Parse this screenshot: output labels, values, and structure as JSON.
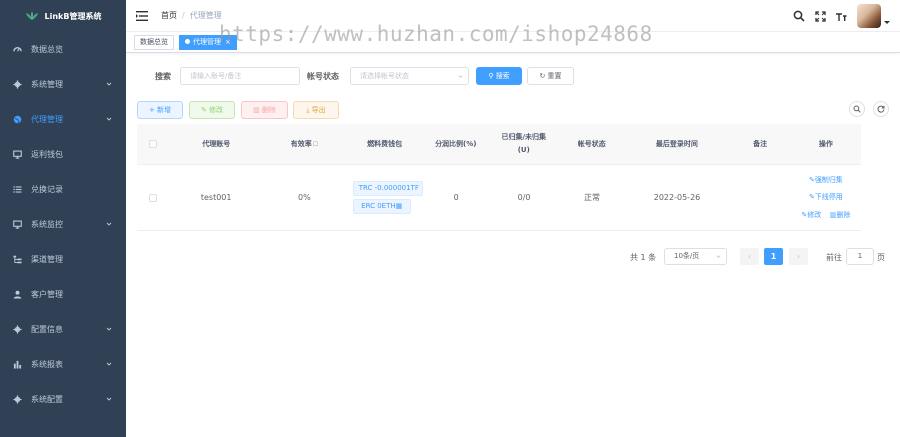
{
  "app": {
    "title": "LinkB管理系统"
  },
  "sidebar": {
    "items": [
      {
        "label": "数据总览",
        "icon": "dashboard-icon",
        "active": false,
        "has_children": false
      },
      {
        "label": "系统管理",
        "icon": "gear-icon",
        "active": false,
        "has_children": true
      },
      {
        "label": "代理管理",
        "icon": "globe-icon",
        "active": true,
        "has_children": true
      },
      {
        "label": "返利钱包",
        "icon": "monitor-icon",
        "active": false,
        "has_children": false
      },
      {
        "label": "兑换记录",
        "icon": "list-icon",
        "active": false,
        "has_children": false
      },
      {
        "label": "系统监控",
        "icon": "monitor-icon",
        "active": false,
        "has_children": true
      },
      {
        "label": "渠道管理",
        "icon": "tree-icon",
        "active": false,
        "has_children": false
      },
      {
        "label": "客户管理",
        "icon": "user-icon",
        "active": false,
        "has_children": false
      },
      {
        "label": "配置信息",
        "icon": "gear-icon",
        "active": false,
        "has_children": true
      },
      {
        "label": "系统报表",
        "icon": "bar-chart-icon",
        "active": false,
        "has_children": true
      },
      {
        "label": "系统配置",
        "icon": "gear-icon",
        "active": false,
        "has_children": true
      }
    ]
  },
  "navbar": {
    "home": "首页",
    "separator": "/",
    "current": "代理管理"
  },
  "tags": {
    "first": "数据总览",
    "active": "代理管理"
  },
  "watermark": "https://www.huzhan.com/ishop24868",
  "search": {
    "keyword_label": "搜索",
    "keyword_placeholder": "请输入账号/备注",
    "status_label": "帐号状态",
    "status_placeholder": "请选择帐号状态",
    "search_button": "搜索",
    "reset_button": "重置"
  },
  "toolbar": {
    "add": "新增",
    "edit": "修改",
    "delete": "删除",
    "export": "导出"
  },
  "table": {
    "headers": {
      "account": "代理账号",
      "efficiency": "有效率",
      "fuel_wallet": "燃料费钱包",
      "share_ratio": "分润比例(%)",
      "collected": "已归集/未归集",
      "collected_unit": "(U)",
      "status": "帐号状态",
      "last_login": "最后登录时间",
      "remark": "备注",
      "actions": "操作"
    },
    "rows": [
      {
        "account": "test001",
        "efficiency": "0%",
        "wallet_trc": "TRC -0.000001TF",
        "wallet_erc": "ERC 0ETH",
        "share_ratio": "0",
        "collected": "0/0",
        "status": "正常",
        "last_login": "2022-05-26",
        "remark": "",
        "actions": {
          "collect": "强制归集",
          "offline": "下线停用",
          "edit": "修改",
          "delete": "删除"
        }
      }
    ]
  },
  "pagination": {
    "total": "共 1 条",
    "page_size": "10条/页",
    "current_page": "1",
    "goto_label": "前往",
    "goto_value": "1",
    "page_unit": "页"
  },
  "colors": {
    "sidebar_bg": "#304156",
    "primary": "#409eff",
    "sidebar_text": "#bfcbd9"
  }
}
